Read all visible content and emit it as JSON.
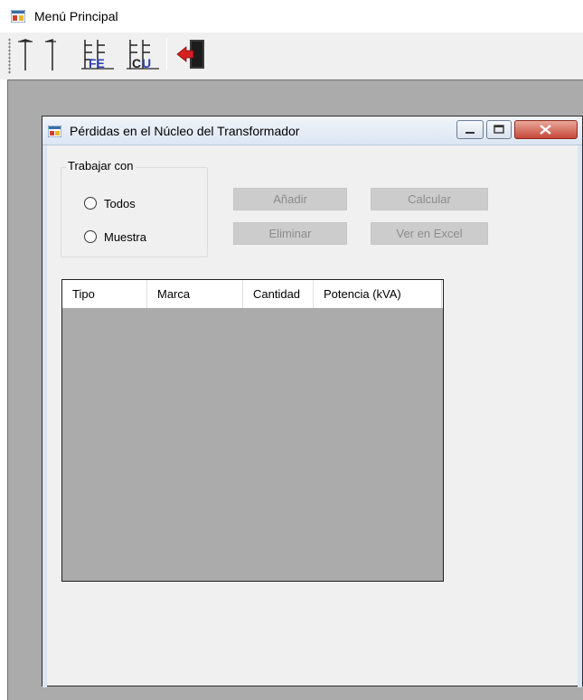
{
  "app": {
    "title": "Menú Principal",
    "icon": "windows-form-icon"
  },
  "toolbar": {
    "buttons": [
      {
        "name": "pole-tool-button",
        "icon": "utility-pole-icon"
      },
      {
        "name": "fe-tool-button",
        "icon": "fe-core-icon",
        "label": "FE"
      },
      {
        "name": "cu-tool-button",
        "icon": "cu-core-icon",
        "label": "CU"
      },
      {
        "name": "exit-button",
        "icon": "exit-door-icon"
      }
    ]
  },
  "child_window": {
    "title": "Pérdidas en el Núcleo del Transformador",
    "groupbox": {
      "legend": "Trabajar con",
      "options": [
        "Todos",
        "Muestra"
      ]
    },
    "buttons": {
      "add": "Añadir",
      "delete": "Eliminar",
      "calculate": "Calcular",
      "excel": "Ver en Excel"
    },
    "grid": {
      "columns": [
        "Tipo",
        "Marca",
        "Cantidad",
        "Potencia (kVA)"
      ],
      "rows": []
    }
  },
  "colors": {
    "mdi_background": "#ababab",
    "form_background": "#f0f0f0",
    "disabled_button": "#cccccc",
    "disabled_text": "#8c8c8c",
    "close_button": "#c7483a"
  }
}
